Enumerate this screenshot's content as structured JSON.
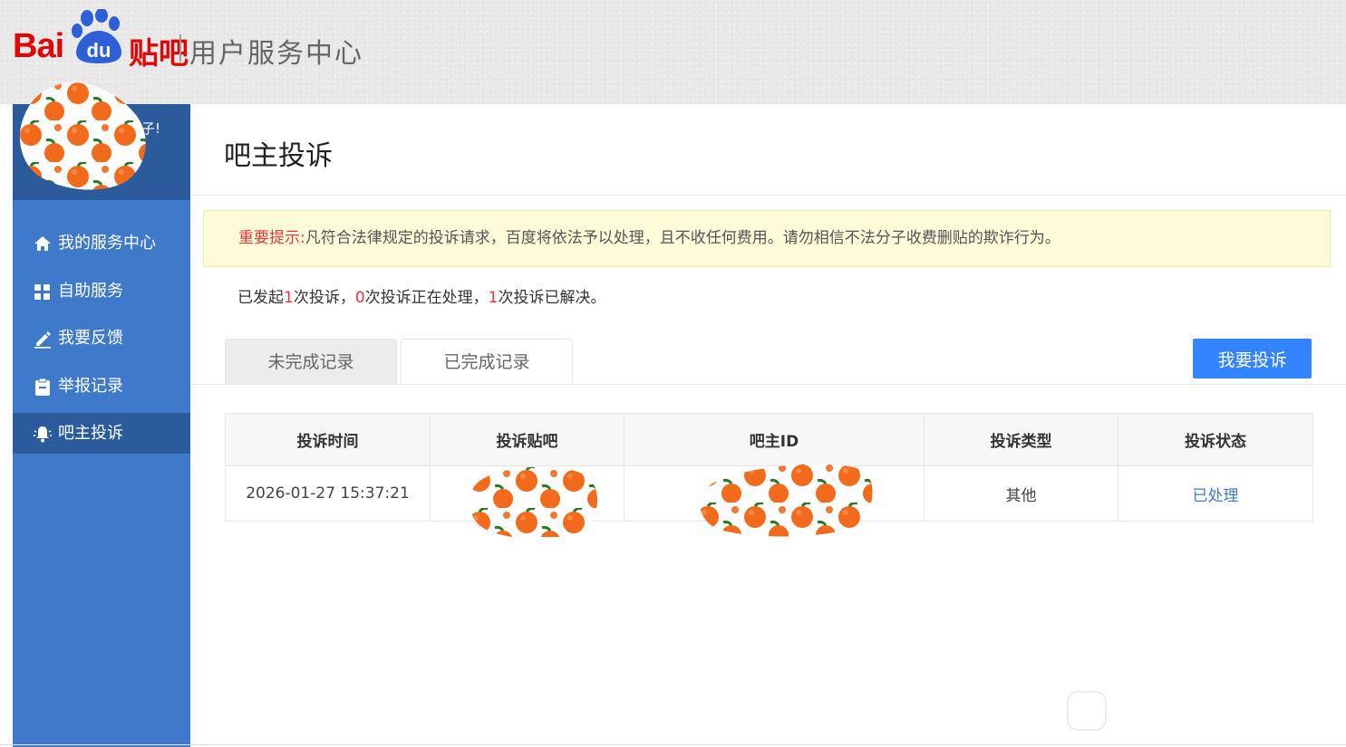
{
  "header": {
    "logo_latin": "Bai",
    "logo_du": "du",
    "logo_product": "贴吧",
    "subtitle": "用户服务中心"
  },
  "sidebar": {
    "greeting": "子!",
    "items": [
      {
        "label": "我的服务中心",
        "icon": "home-icon",
        "active": false
      },
      {
        "label": "自助服务",
        "icon": "grid-icon",
        "active": false
      },
      {
        "label": "我要反馈",
        "icon": "edit-icon",
        "active": false
      },
      {
        "label": "举报记录",
        "icon": "clipboard-icon",
        "active": false
      },
      {
        "label": "吧主投诉",
        "icon": "bell-icon",
        "active": true
      }
    ]
  },
  "main": {
    "title": "吧主投诉",
    "notice": {
      "label": "重要提示:",
      "text": "凡符合法律规定的投诉请求，百度将依法予以处理，且不收任何费用。请勿相信不法分子收费删贴的欺诈行为。"
    },
    "stats": {
      "prefix": "已发起",
      "total": "1",
      "part1": "次投诉，",
      "processing": "0",
      "part2": "次投诉正在处理，",
      "resolved": "1",
      "part3": "次投诉已解决。"
    },
    "tabs": [
      {
        "label": "未完成记录"
      },
      {
        "label": "已完成记录"
      }
    ],
    "complain_button": "我要投诉",
    "table": {
      "headers": [
        "投诉时间",
        "投诉贴吧",
        "吧主ID",
        "投诉类型",
        "投诉状态"
      ],
      "rows": [
        {
          "time": "2026-01-27 15:37:21",
          "type": "其他",
          "status": "已处理"
        }
      ]
    }
  },
  "colors": {
    "brand_red": "#e10602",
    "sidebar_blue": "#3e7ac9",
    "sidebar_dark": "#2b5b9b",
    "button_blue": "#3385ff",
    "notice_bg": "#fefbd9",
    "highlight_red": "#e4393c"
  }
}
